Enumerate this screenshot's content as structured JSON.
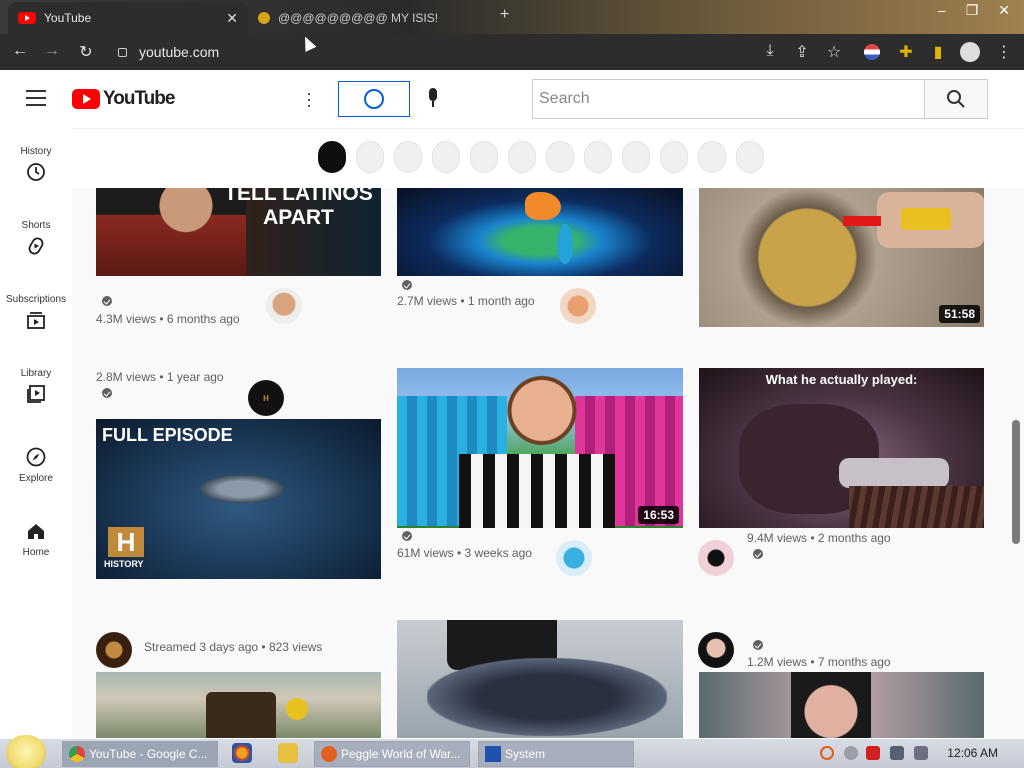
{
  "browser": {
    "active_tab_title": "YouTube",
    "inactive_tab_title": "@@@@@@@@@ MY ISIS!",
    "url": "youtube.com"
  },
  "youtube": {
    "logo_text": "YouTube",
    "search_placeholder": "Search",
    "sidebar": [
      {
        "label": "History",
        "icon": "history-icon"
      },
      {
        "label": "Shorts",
        "icon": "shorts-icon"
      },
      {
        "label": "Subscriptions",
        "icon": "subscriptions-icon"
      },
      {
        "label": "Library",
        "icon": "library-icon"
      },
      {
        "label": "Explore",
        "icon": "compass-icon"
      },
      {
        "label": "Home",
        "icon": "home-icon"
      }
    ],
    "thumb_texts": {
      "latinos": "TELL LATINOS APART",
      "full_episode": "FULL EPISODE",
      "history_logo": "HISTORY",
      "played_caption": "What he actually played:"
    },
    "videos": [
      {
        "meta": "4.3M views • 6 months ago"
      },
      {
        "meta": "2.7M views • 1 month ago"
      },
      {
        "meta": "",
        "duration": "51:58"
      },
      {
        "meta": "2.8M views • 1 year ago"
      },
      {
        "meta": "61M views • 3 weeks ago",
        "duration": "16:53"
      },
      {
        "meta": "9.4M views • 2 months ago"
      },
      {
        "meta": "Streamed 3 days ago • 823 views"
      },
      {
        "meta": ""
      },
      {
        "meta": "1.2M views • 7 months ago"
      }
    ]
  },
  "taskbar": {
    "tasks": [
      {
        "label": "YouTube - Google C..."
      },
      {
        "label": "Peggle World of War..."
      },
      {
        "label": "System"
      }
    ],
    "time": "12:06 AM"
  }
}
